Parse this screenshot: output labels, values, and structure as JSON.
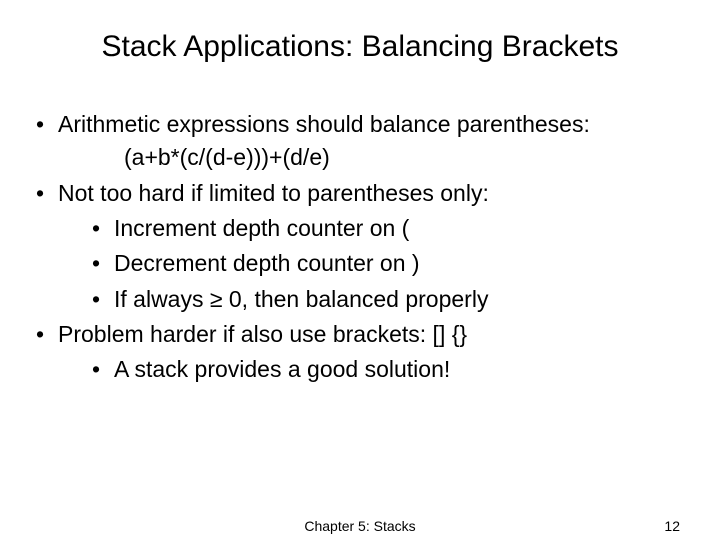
{
  "title": "Stack Applications: Balancing Brackets",
  "bullets": {
    "b1": "Arithmetic expressions should balance parentheses:",
    "expr": "(a+b*(c/(d-e)))+(d/e)",
    "b2": "Not too hard if limited to parentheses only:",
    "b2_sub": {
      "s1": "Increment depth counter on (",
      "s2": "Decrement depth counter on )",
      "s3": "If always ≥ 0, then balanced properly"
    },
    "b3": "Problem harder if also use brackets: [] {}",
    "b3_sub": {
      "s1": "A stack provides a good solution!"
    }
  },
  "footer": {
    "center": "Chapter 5: Stacks",
    "page": "12"
  }
}
